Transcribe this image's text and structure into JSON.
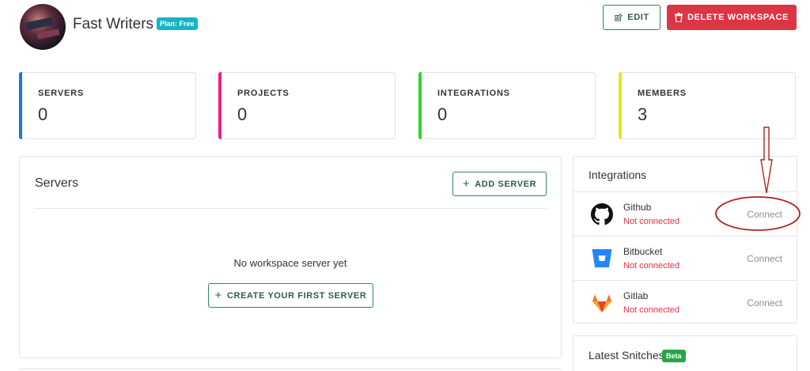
{
  "workspace": {
    "name": "Fast Writers",
    "plan_badge": "Plan: Free"
  },
  "actions": {
    "edit_label": "EDIT",
    "delete_label": "DELETE WORKSPACE"
  },
  "stats": [
    {
      "label": "SERVERS",
      "value": "0",
      "color": "#1a73e8"
    },
    {
      "label": "PROJECTS",
      "value": "0",
      "color": "#e91e8c"
    },
    {
      "label": "INTEGRATIONS",
      "value": "0",
      "color": "#2ed52e"
    },
    {
      "label": "MEMBERS",
      "value": "3",
      "color": "#e0ea1a"
    }
  ],
  "servers": {
    "title": "Servers",
    "add_label": "ADD SERVER",
    "empty_text": "No workspace server yet",
    "create_label": "CREATE YOUR FIRST SERVER"
  },
  "integrations": {
    "title": "Integrations",
    "items": [
      {
        "name": "Github",
        "status": "Not connected",
        "action": "Connect",
        "icon": "github-icon"
      },
      {
        "name": "Bitbucket",
        "status": "Not connected",
        "action": "Connect",
        "icon": "bitbucket-icon"
      },
      {
        "name": "Gitlab",
        "status": "Not connected",
        "action": "Connect",
        "icon": "gitlab-icon"
      }
    ]
  },
  "snitches": {
    "title": "Latest Snitches",
    "badge": "Beta"
  },
  "colors": {
    "primary_green": "#2e8b57",
    "danger": "#dc3545",
    "info": "#17b3c7",
    "success": "#28a745",
    "annotation": "#b22222"
  }
}
